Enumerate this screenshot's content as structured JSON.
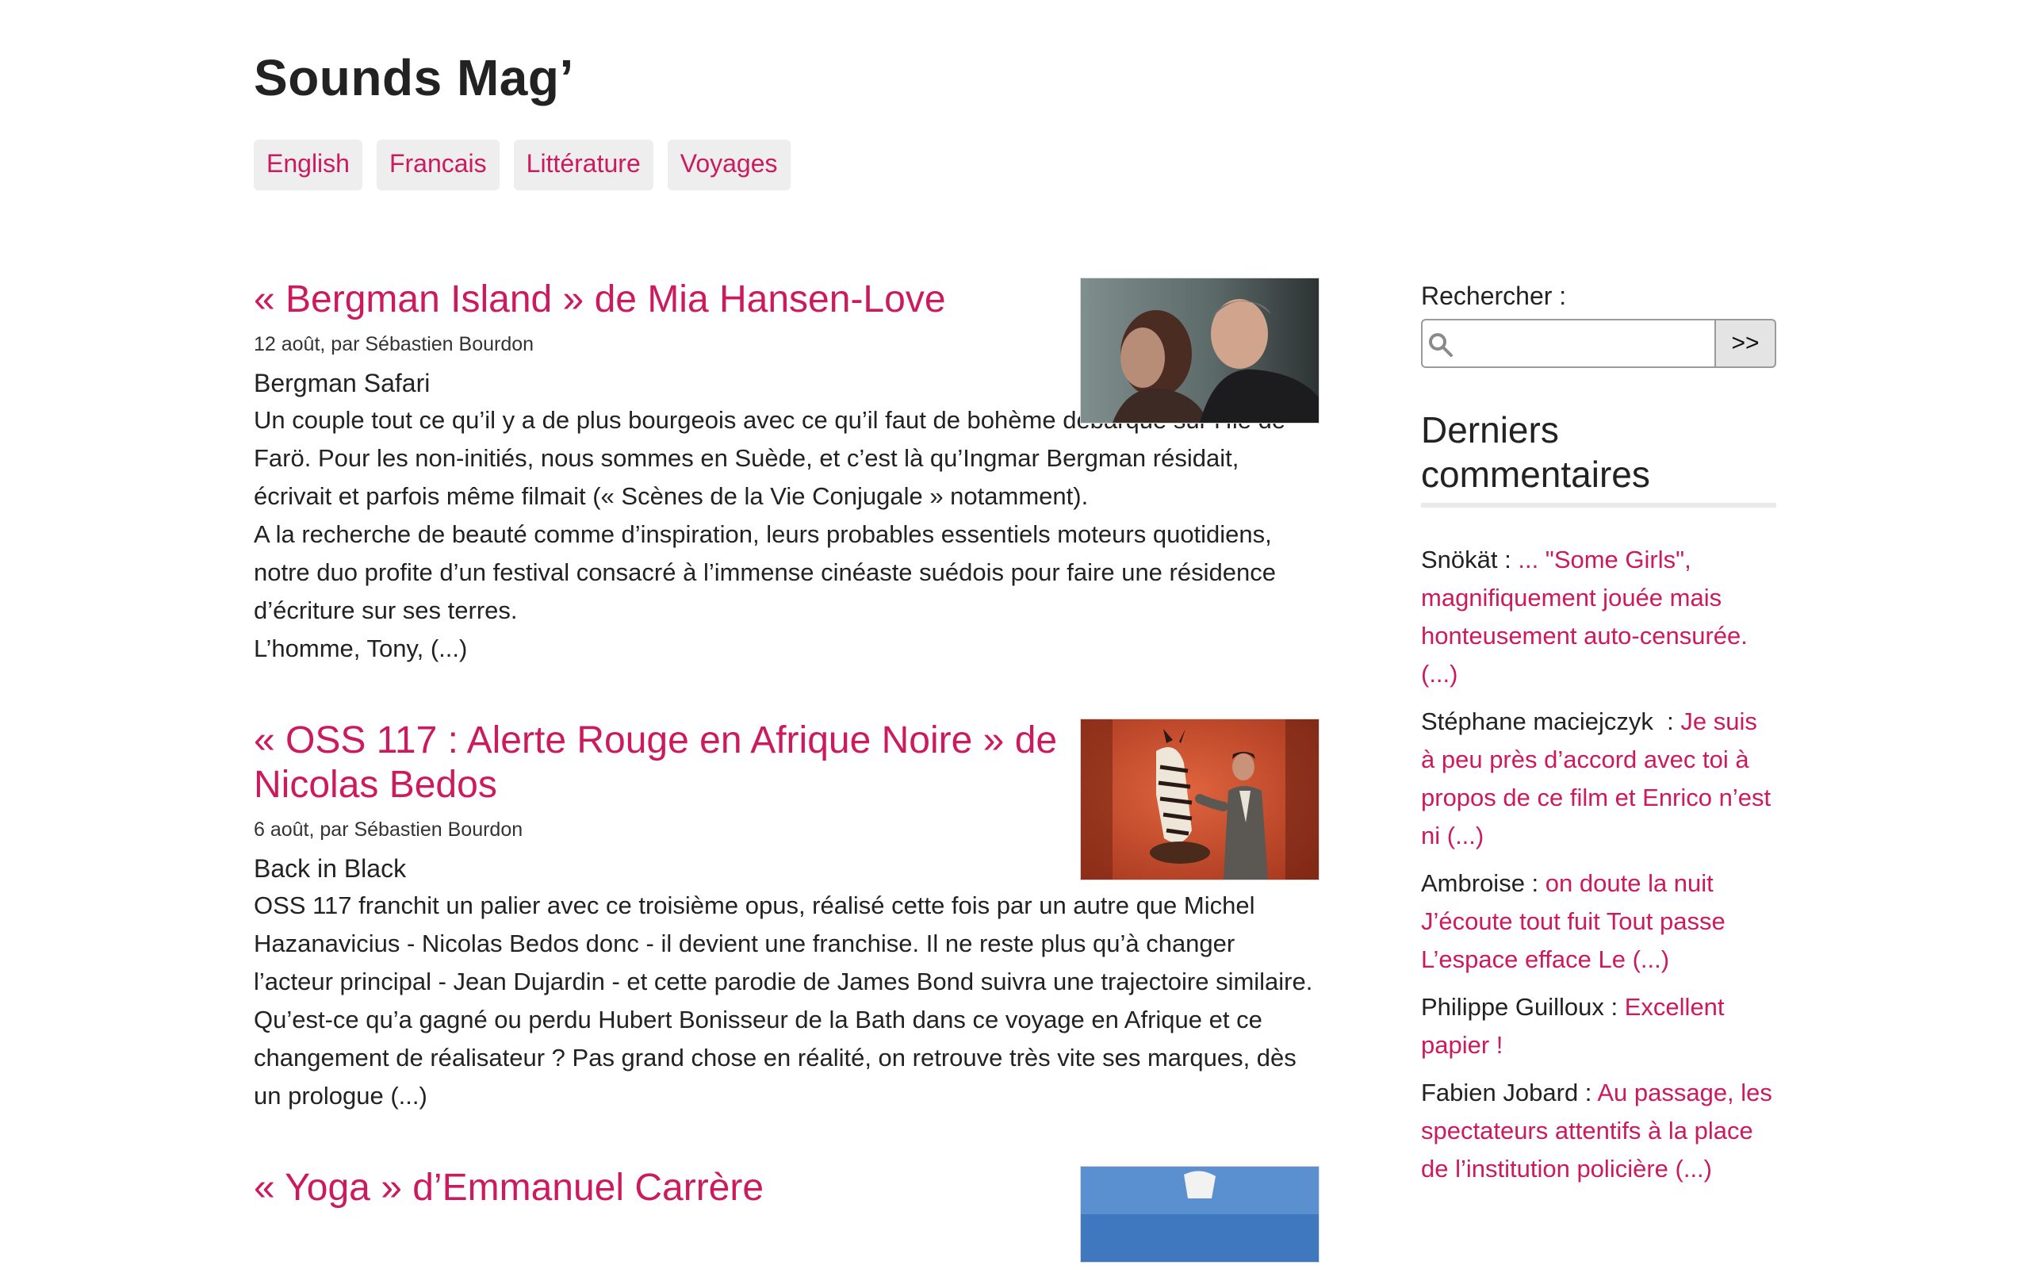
{
  "site": {
    "title": "Sounds Mag’"
  },
  "nav": [
    {
      "label": "English"
    },
    {
      "label": "Francais"
    },
    {
      "label": "Littérature"
    },
    {
      "label": "Voyages"
    }
  ],
  "articles": [
    {
      "title": "« Bergman Island » de Mia Hansen-Love",
      "meta": "12 août, par Sébastien Bourdon",
      "subtitle": "Bergman Safari",
      "paragraphs": [
        "Un couple tout ce qu’il y a de plus bourgeois avec ce qu’il faut de bohème débarque sur l’île de Farö. Pour les non-initiés, nous sommes en Suède, et c’est là qu’Ingmar Bergman résidait, écrivait et parfois même filmait (« Scènes de la Vie Conjugale » notamment).",
        "A la recherche de beauté comme d’inspiration, leurs probables essentiels moteurs quotidiens, notre duo profite d’un festival consacré à l’immense cinéaste suédois pour faire une résidence d’écriture sur ses terres.",
        "L’homme, Tony, (...)"
      ]
    },
    {
      "title": "« OSS 117 : Alerte Rouge en Afrique Noire » de Nicolas Bedos",
      "meta": "6 août, par Sébastien Bourdon",
      "subtitle": "Back in Black",
      "paragraphs": [
        "OSS 117 franchit un palier avec ce troisième opus, réalisé cette fois par un autre que Michel Hazanavicius - Nicolas Bedos donc - il devient une franchise. Il ne reste plus qu’à changer l’acteur principal - Jean Dujardin - et cette parodie de James Bond suivra une trajectoire similaire.",
        "Qu’est-ce qu’a gagné ou perdu Hubert Bonisseur de la Bath dans ce voyage en Afrique et ce changement de réalisateur ? Pas grand chose en réalité, on retrouve très vite ses marques, dès un prologue (...)"
      ]
    },
    {
      "title": "« Yoga » d’Emmanuel Carrère"
    }
  ],
  "sidebar": {
    "search_label": "Rechercher :",
    "search_value": "",
    "search_button": ">>",
    "comments_title": "Derniers commentaires",
    "comments": [
      {
        "author": "Snökät : ",
        "text": "... \"Some Girls\", magnifiquement jouée mais honteusement auto-censurée. (...)"
      },
      {
        "author": "Stéphane maciejczyk  : ",
        "text": "Je suis à peu près d’accord avec toi à propos de ce film et Enrico n’est ni (...)"
      },
      {
        "author": "Ambroise : ",
        "text": "on doute la nuit J’écoute tout fuit Tout passe L’espace efface Le (...)"
      },
      {
        "author": "Philippe Guilloux : ",
        "text": "Excellent papier !"
      },
      {
        "author": "Fabien Jobard : ",
        "text": "Au passage, les spectateurs attentifs à la place de l’institution policière (...)"
      }
    ]
  },
  "colors": {
    "accent": "#cc1a5e",
    "text": "#222222",
    "tag_bg": "#eeeeee"
  }
}
